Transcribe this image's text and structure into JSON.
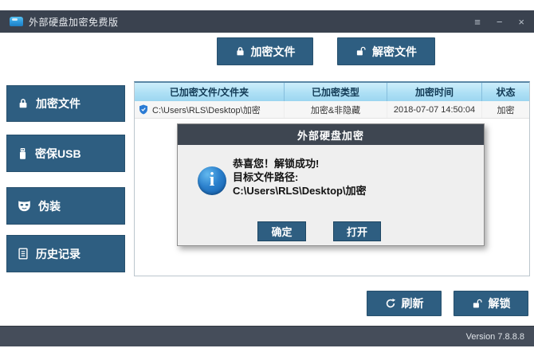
{
  "window": {
    "title": "外部硬盘加密免费版",
    "controls": {
      "menu": "≡",
      "minimize": "−",
      "close": "×"
    }
  },
  "toolbar": {
    "encrypt_label": "加密文件",
    "decrypt_label": "解密文件"
  },
  "sidebar": {
    "items": [
      {
        "label": "加密文件",
        "icon": "lock-closed-icon"
      },
      {
        "label": "密保USB",
        "icon": "usb-icon"
      },
      {
        "label": "伪装",
        "icon": "mask-icon"
      },
      {
        "label": "历史记录",
        "icon": "history-icon"
      }
    ]
  },
  "table": {
    "headers": [
      "已加密文件/文件夹",
      "已加密类型",
      "加密时间",
      "状态"
    ],
    "rows": [
      {
        "icon": "shield-check-icon",
        "path": "C:\\Users\\RLS\\Desktop\\加密",
        "type": "加密&非隐藏",
        "time": "2018-07-07 14:50:04",
        "status": "加密"
      }
    ]
  },
  "dialog": {
    "title": "外部硬盘加密",
    "icon": "info-icon",
    "message_line1": "恭喜您！解锁成功!",
    "message_line2": "目标文件路径:",
    "message_line3": "C:\\Users\\RLS\\Desktop\\加密",
    "ok_label": "确定",
    "open_label": "打开"
  },
  "footer": {
    "refresh_label": "刷新",
    "unlock_label": "解锁"
  },
  "statusbar": {
    "version": "Version 7.8.8.8"
  },
  "colors": {
    "titlebar": "#3a424f",
    "statusbar": "#454d5a",
    "button_blue": "#2e5e81",
    "dialog_titlebar": "#3e4651",
    "table_header_top": "#cdeefb",
    "table_header_bottom": "#9cd6f0",
    "info_icon_blue": "#1465b4"
  }
}
